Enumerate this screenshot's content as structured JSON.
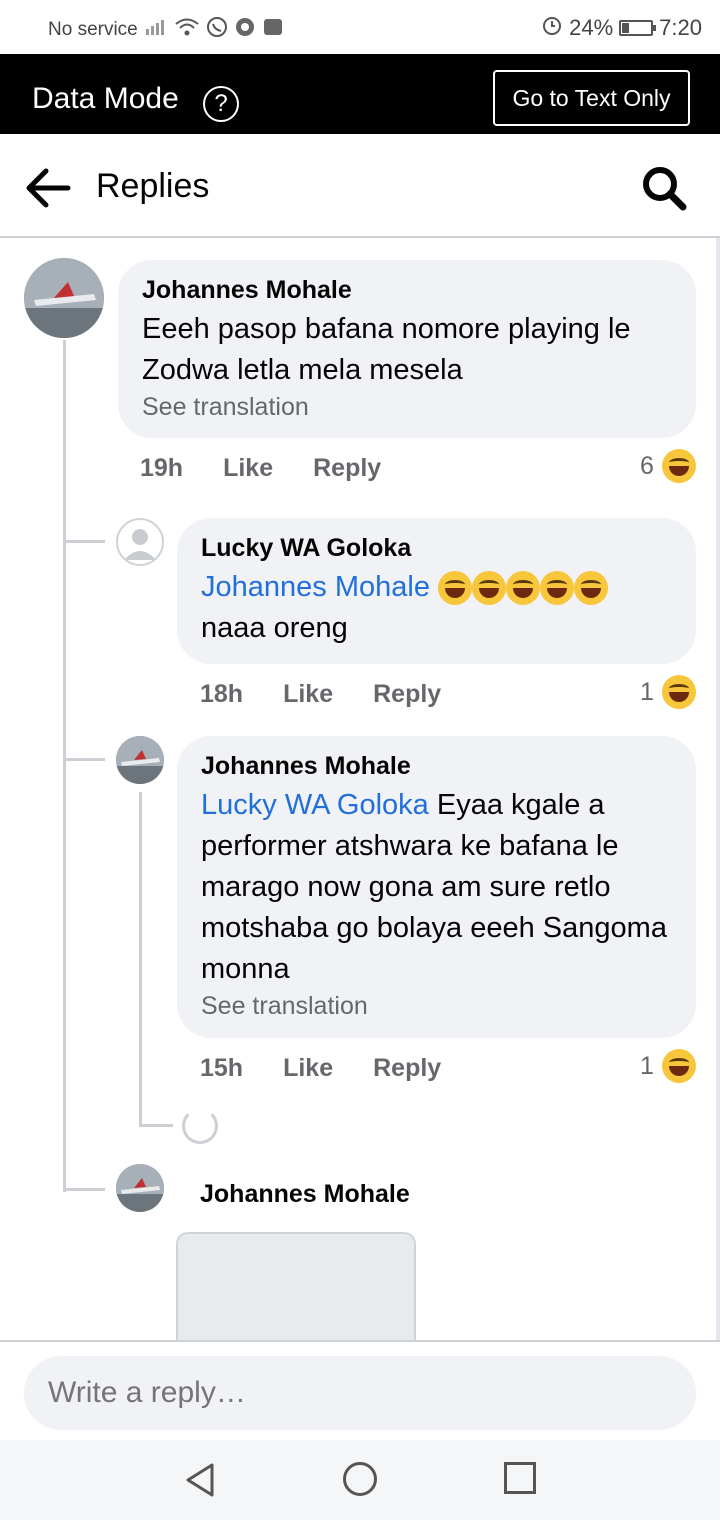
{
  "status_bar": {
    "carrier": "No service",
    "battery": "24%",
    "battery_level": 0.24,
    "time": "7:20"
  },
  "data_bar": {
    "title": "Data Mode",
    "help_glyph": "?",
    "text_only_label": "Go to Text Only"
  },
  "header": {
    "title": "Replies"
  },
  "comments": [
    {
      "author": "Johannes Mohale",
      "mention": "",
      "text": "Eeeh pasop bafana nomore playing le Zodwa letla mela mesela",
      "see_translation": "See translation",
      "time": "19h",
      "like": "Like",
      "reply": "Reply",
      "reaction_count": "6"
    },
    {
      "author": "Lucky WA Goloka",
      "mention": "Johannes Mohale",
      "text": "naaa oreng",
      "time": "18h",
      "like": "Like",
      "reply": "Reply",
      "reaction_count": "1"
    },
    {
      "author": "Johannes Mohale",
      "mention": "Lucky WA Goloka",
      "text": "Eyaa kgale a performer atshwara ke bafana le marago now gona am sure retlo motshaba go bolaya eeeh Sangoma monna",
      "see_translation": "See translation",
      "time": "15h",
      "like": "Like",
      "reply": "Reply",
      "reaction_count": "1"
    },
    {
      "author": "Johannes Mohale"
    }
  ],
  "reply_input": {
    "placeholder": "Write a reply…"
  },
  "colors": {
    "link": "#216fdb",
    "bubble": "#f0f2f5",
    "muted": "#65676b"
  },
  "icons": {
    "back": "arrow-left-icon",
    "search": "search-icon",
    "help": "question-circle-icon",
    "reaction": "laughing-emoji-icon"
  }
}
